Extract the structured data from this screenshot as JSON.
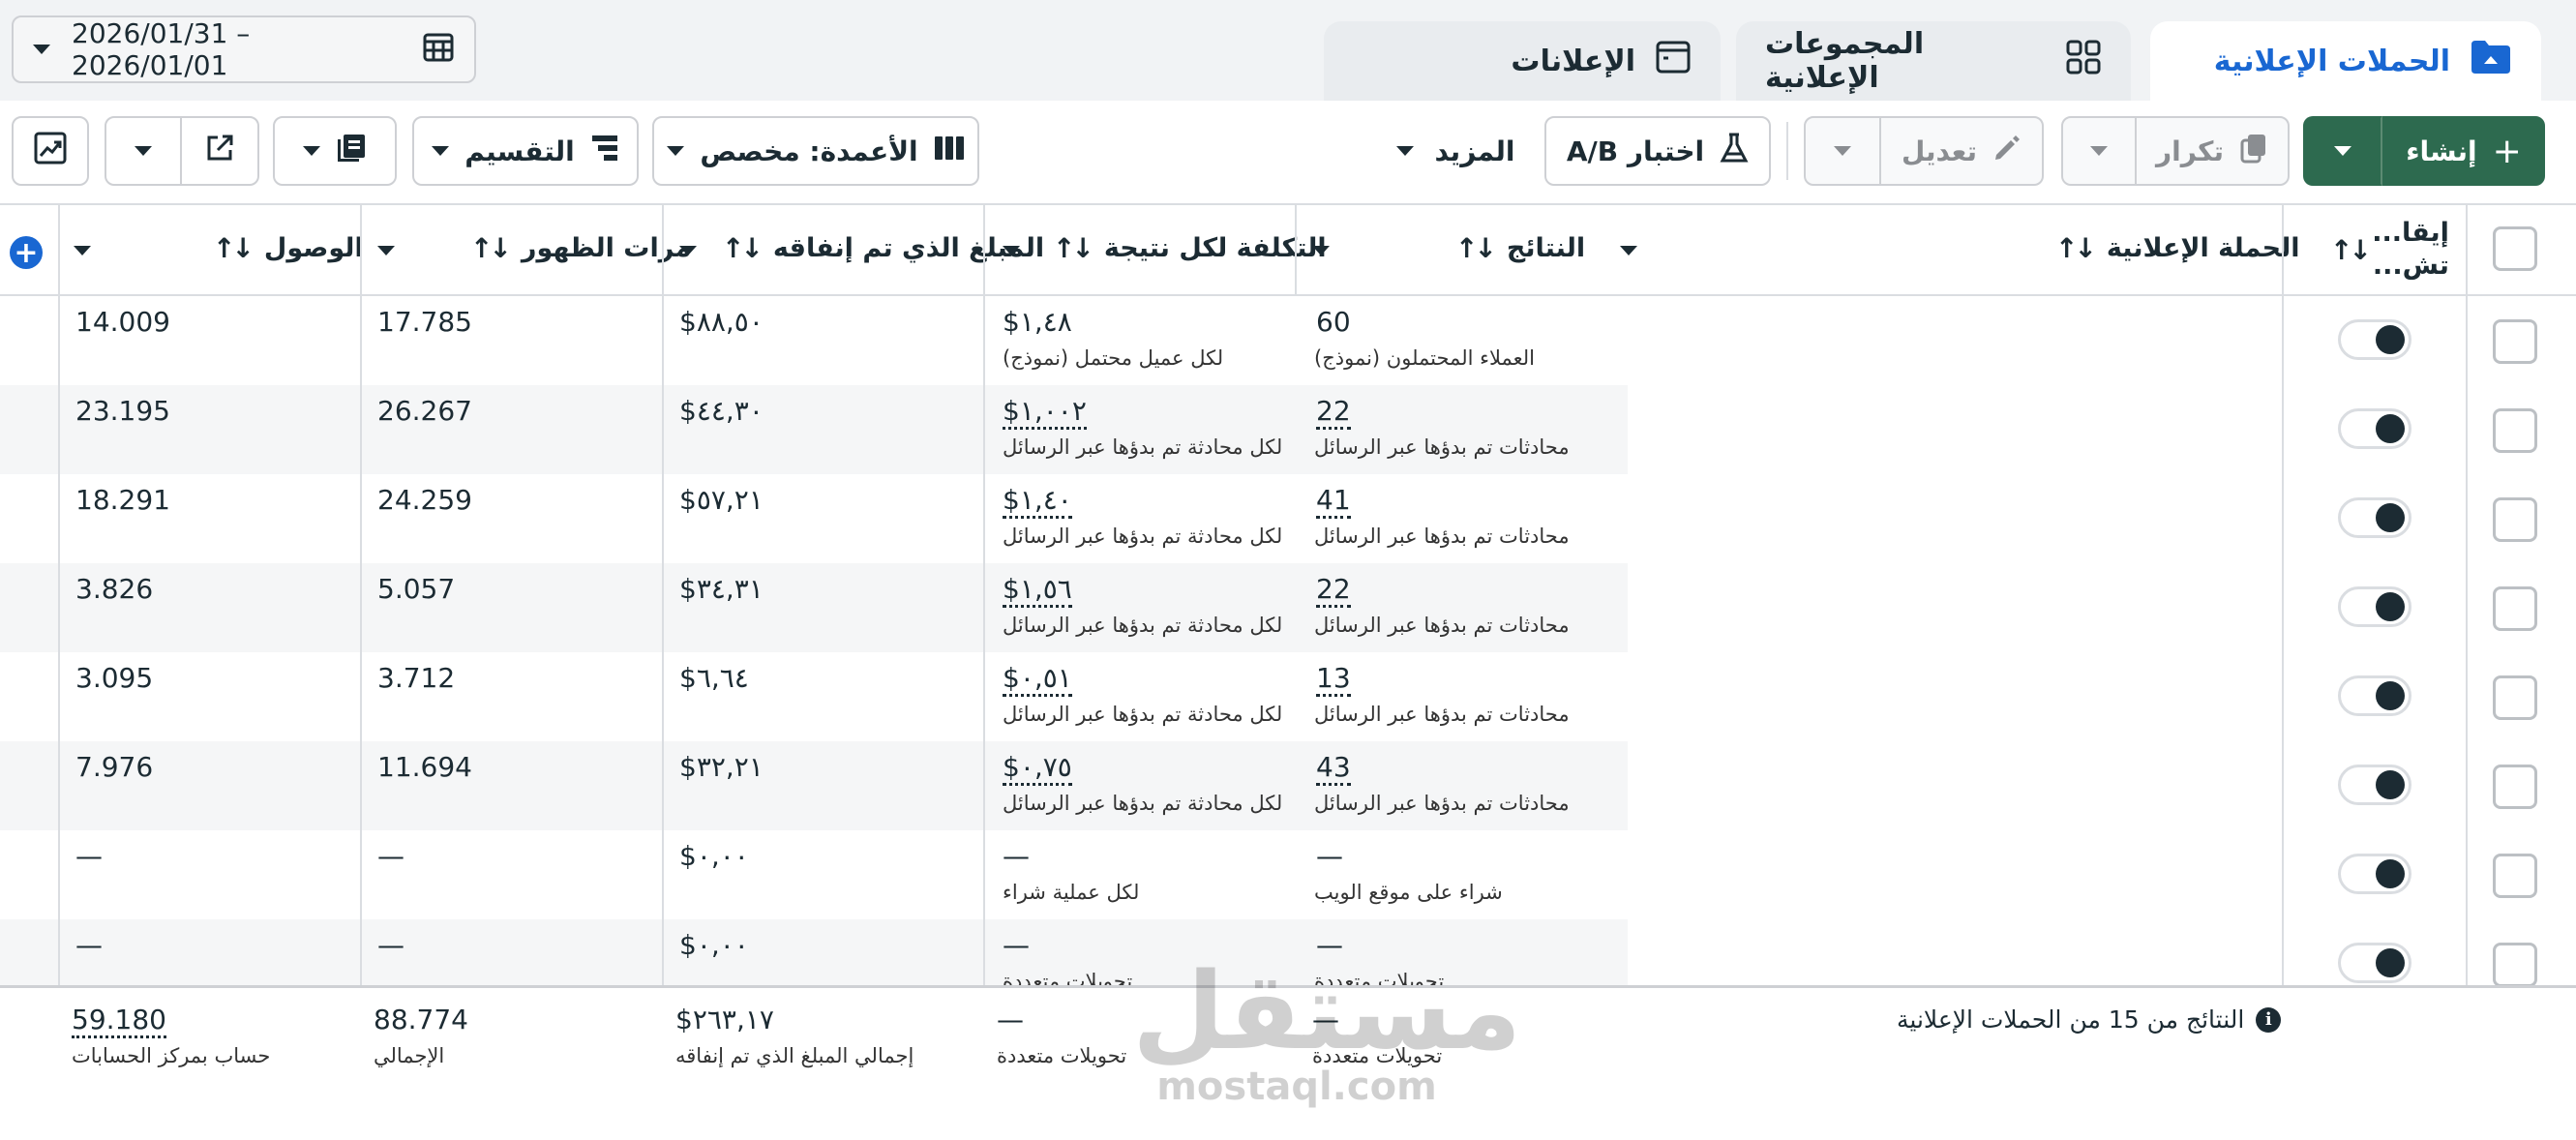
{
  "tabs": {
    "campaigns": "الحملات الإعلانية",
    "ad_sets": "المجموعات الإعلانية",
    "ads": "الإعلانات"
  },
  "date_range": "2026/01/31 – 2026/01/01",
  "toolbar": {
    "create": "إنشاء",
    "duplicate": "تكرار",
    "edit": "تعديل",
    "ab_test": "اختبار A/B",
    "more": "المزيد",
    "columns": "الأعمدة: مخصص",
    "breakdown": "التقسيم"
  },
  "columns": {
    "status": "إيقا... تش...",
    "campaign": "الحملة الإعلانية",
    "results": "النتائج",
    "cost_per_result": "التكلفة لكل نتيجة",
    "amount_spent": "المبلغ الذي تم إنفاقه",
    "impressions": "مرات الظهور",
    "reach": "الوصول"
  },
  "rows": [
    {
      "results": "60",
      "results_label": "العملاء المحتملون (نموذج)",
      "cost": "$١,٤٨",
      "cost_label": "لكل عميل محتمل (نموذج)",
      "spent": "$٨٨,٥٠",
      "impressions": "17.785",
      "reach": "14.009"
    },
    {
      "results": "22",
      "results_label": "محادثات تم بدؤها عبر الرسائل",
      "cost": "$١,٠٠٢",
      "cost_label": "لكل محادثة تم بدؤها عبر الرسائل",
      "spent": "$٤٤,٣٠",
      "impressions": "26.267",
      "reach": "23.195"
    },
    {
      "results": "41",
      "results_label": "محادثات تم بدؤها عبر الرسائل",
      "cost": "$١,٤٠",
      "cost_label": "لكل محادثة تم بدؤها عبر الرسائل",
      "spent": "$٥٧,٢١",
      "impressions": "24.259",
      "reach": "18.291"
    },
    {
      "results": "22",
      "results_label": "محادثات تم بدؤها عبر الرسائل",
      "cost": "$١,٥٦",
      "cost_label": "لكل محادثة تم بدؤها عبر الرسائل",
      "spent": "$٣٤,٣١",
      "impressions": "5.057",
      "reach": "3.826"
    },
    {
      "results": "13",
      "results_label": "محادثات تم بدؤها عبر الرسائل",
      "cost": "$٠,٥١",
      "cost_label": "لكل محادثة تم بدؤها عبر الرسائل",
      "spent": "$٦,٦٤",
      "impressions": "3.712",
      "reach": "3.095"
    },
    {
      "results": "43",
      "results_label": "محادثات تم بدؤها عبر الرسائل",
      "cost": "$٠,٧٥",
      "cost_label": "لكل محادثة تم بدؤها عبر الرسائل",
      "spent": "$٣٢,٢١",
      "impressions": "11.694",
      "reach": "7.976"
    },
    {
      "results": "—",
      "results_label": "شراء على موقع الويب",
      "cost": "—",
      "cost_label": "لكل عملية شراء",
      "spent": "$٠,٠٠",
      "impressions": "—",
      "reach": "—"
    },
    {
      "results": "—",
      "results_label": "تحويلات متعددة",
      "cost": "—",
      "cost_label": "تحويلات متعددة",
      "spent": "$٠,٠٠",
      "impressions": "—",
      "reach": "—"
    }
  ],
  "footer": {
    "summary": "النتائج من 15 من الحملات الإعلانية",
    "results": "—",
    "results_label": "تحويلات متعددة",
    "cost": "—",
    "cost_label": "تحويلات متعددة",
    "spent": "$٢٦٣,١٧",
    "spent_label": "إجمالي المبلغ الذي تم إنفاقه",
    "impressions": "88.774",
    "impressions_label": "الإجمالي",
    "reach": "59.180",
    "reach_label": "حساب بمركز الحسابات"
  },
  "watermark": {
    "arabic": "مستقل",
    "latin": "mostaql.com"
  },
  "colors": {
    "accent": "#1967d2",
    "create": "#2d6a4f",
    "text": "#1c2b33",
    "border": "#dadde1"
  }
}
